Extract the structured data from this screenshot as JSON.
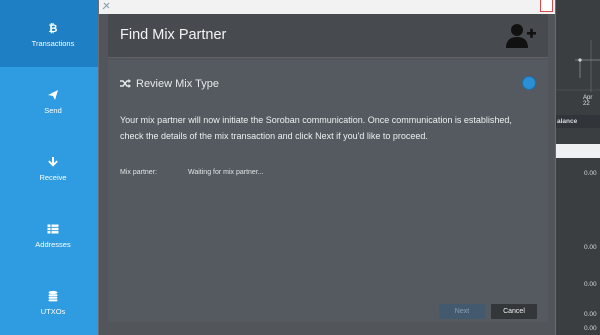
{
  "sidebar": {
    "items": [
      {
        "label": "Transactions",
        "icon": "bitcoin-icon",
        "active": true
      },
      {
        "label": "Send",
        "icon": "paper-plane-icon"
      },
      {
        "label": "Receive",
        "icon": "arrow-down-icon"
      },
      {
        "label": "Addresses",
        "icon": "list-icon"
      },
      {
        "label": "UTXOs",
        "icon": "coins-icon"
      }
    ]
  },
  "background": {
    "chart_date": "Apr 22",
    "table_header": "alance",
    "values": [
      "0.00",
      "0.00",
      "0.00",
      "0.00",
      "0.00"
    ]
  },
  "dialog": {
    "title": "Find Mix Partner",
    "header_icon": "add-user-icon",
    "step_title": "Review Mix Type",
    "description": "Your mix partner will now initiate the Soroban communication. Once communication is established, check the details of the mix transaction and click Next if you'd like to proceed.",
    "mix_partner_label": "Mix partner:",
    "mix_partner_status": "Waiting for mix partner...",
    "next_label": "Next",
    "cancel_label": "Cancel"
  },
  "colors": {
    "sidebar": "#2f9be0",
    "sidebar_active": "#1e7fc4",
    "dialog_bg": "#52565a",
    "step_dot": "#2b8fd6"
  }
}
